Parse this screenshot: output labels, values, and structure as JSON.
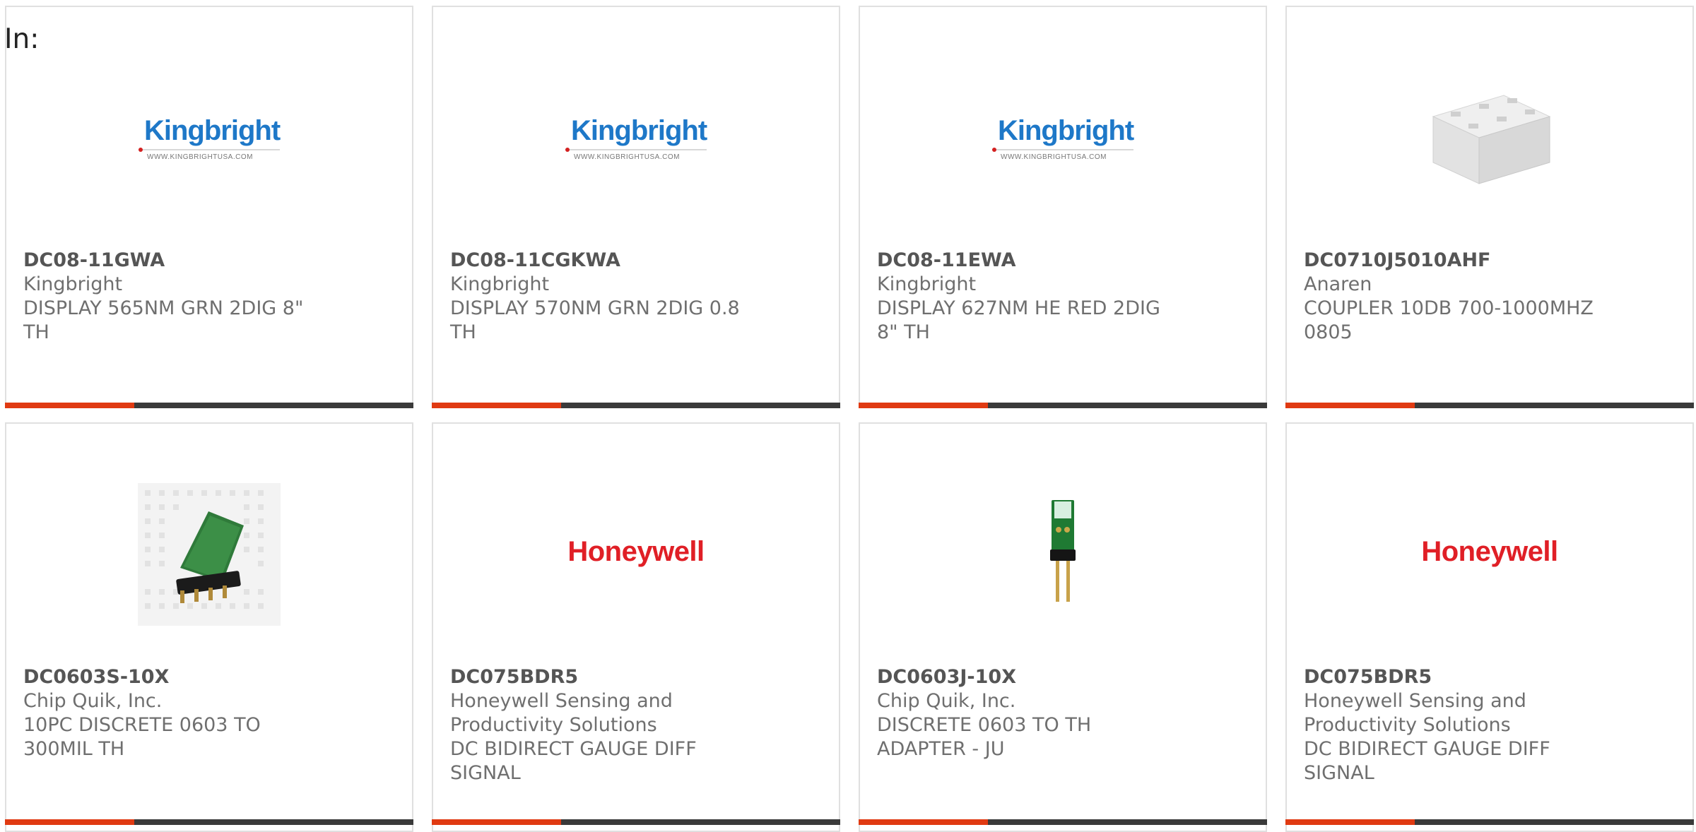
{
  "filter": {
    "label": "In:"
  },
  "accent_color": "#e03a12",
  "bar_color": "#3a3a3a",
  "logos": {
    "kingbright": {
      "word": "Kingbright",
      "url": "WWW.KINGBRIGHTUSA.COM"
    },
    "honeywell": {
      "word": "Honeywell"
    }
  },
  "products": [
    {
      "part_number": "DC08-11GWA",
      "manufacturer": "Kingbright",
      "description": "DISPLAY 565NM GRN 2DIG 8\" TH",
      "image": "kingbright-logo"
    },
    {
      "part_number": "DC08-11CGKWA",
      "manufacturer": "Kingbright",
      "description": "DISPLAY 570NM GRN 2DIG 0.8 TH",
      "image": "kingbright-logo"
    },
    {
      "part_number": "DC08-11EWA",
      "manufacturer": "Kingbright",
      "description": "DISPLAY 627NM HE RED 2DIG 8\" TH",
      "image": "kingbright-logo"
    },
    {
      "part_number": "DC0710J5010AHF",
      "manufacturer": "Anaren",
      "description": "COUPLER 10DB 700-1000MHZ 0805",
      "image": "coupler-chip-photo"
    },
    {
      "part_number": "DC0603S-10X",
      "manufacturer": "Chip Quik, Inc.",
      "description": "10PC DISCRETE 0603 TO 300MIL TH",
      "image": "adapter-on-breadboard-photo"
    },
    {
      "part_number": "DC075BDR5",
      "manufacturer": "Honeywell Sensing and Productivity Solutions",
      "description": "DC BIDIRECT GAUGE DIFF SIGNAL",
      "image": "honeywell-logo"
    },
    {
      "part_number": "DC0603J-10X",
      "manufacturer": "Chip Quik, Inc.",
      "description": "DISCRETE 0603 TO TH ADAPTER - JU",
      "image": "adapter-pcb-photo"
    },
    {
      "part_number": "DC075BDR5",
      "manufacturer": "Honeywell Sensing and Productivity Solutions",
      "description": "DC BIDIRECT GAUGE DIFF SIGNAL",
      "image": "honeywell-logo"
    }
  ]
}
